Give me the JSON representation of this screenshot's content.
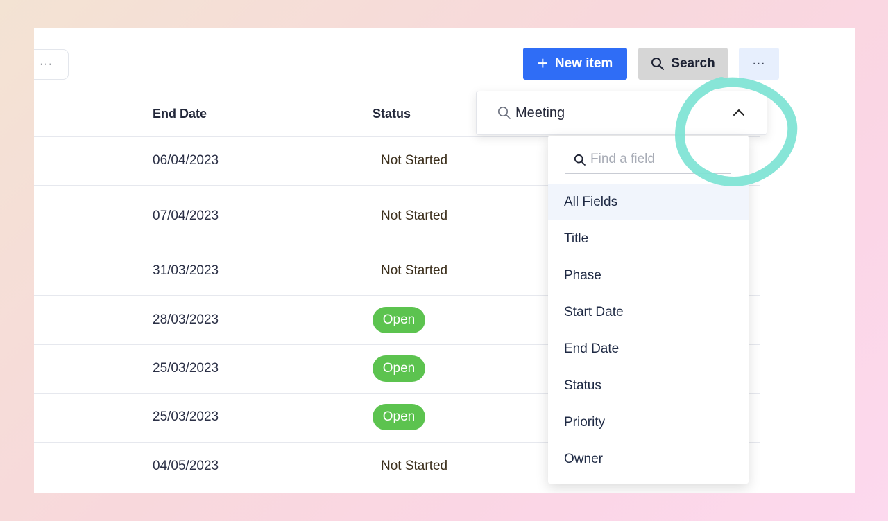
{
  "toolbar": {
    "more_left_label": "···",
    "new_item_label": "New item",
    "new_item_icon": "plus-icon",
    "search_label": "Search",
    "search_icon": "search-icon",
    "more_label": "···",
    "accent_color": "#2f6df6"
  },
  "table": {
    "headers": {
      "end_date": "End Date",
      "status": "Status"
    },
    "rows": [
      {
        "end_date": "06/04/2023",
        "status": "Not Started",
        "status_kind": "text"
      },
      {
        "end_date": "07/04/2023",
        "status": "Not Started",
        "status_kind": "text"
      },
      {
        "end_date": "31/03/2023",
        "status": "Not Started",
        "status_kind": "text"
      },
      {
        "end_date": "28/03/2023",
        "status": "Open",
        "status_kind": "pill"
      },
      {
        "end_date": "25/03/2023",
        "status": "Open",
        "status_kind": "pill"
      },
      {
        "end_date": "25/03/2023",
        "status": "Open",
        "status_kind": "pill"
      },
      {
        "end_date": "04/05/2023",
        "status": "Not Started",
        "status_kind": "text"
      }
    ],
    "open_color": "#5cc34f"
  },
  "search_panel": {
    "query": "Meeting",
    "field_search_placeholder": "Find a field",
    "fields": [
      "All Fields",
      "Title",
      "Phase",
      "Start Date",
      "End Date",
      "Status",
      "Priority",
      "Owner"
    ],
    "selected_field": "All Fields",
    "highlight_color": "#7de3d4"
  }
}
